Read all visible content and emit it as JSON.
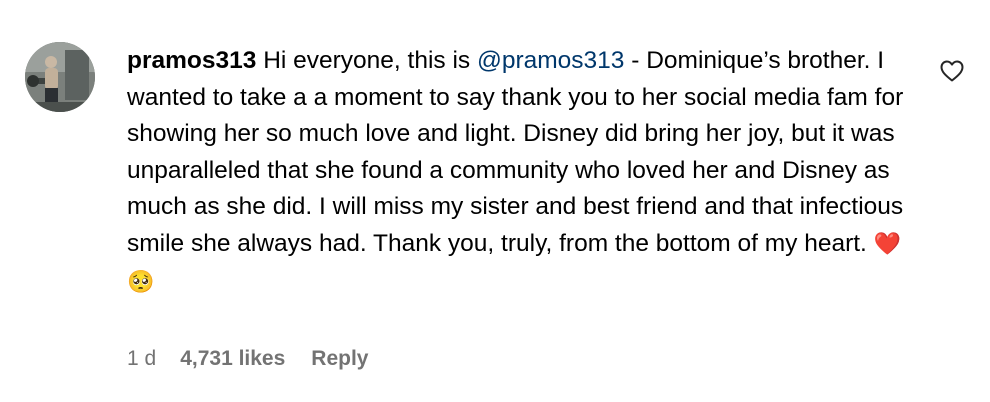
{
  "comment": {
    "username": "pramos313",
    "text_before_mention": "Hi everyone, this is ",
    "mention": "@pramos313",
    "text_after_mention": " - Dominique’s brother. I wanted to take a a moment to say thank you to her social media fam for showing her so much love and light. Disney did bring her joy, but it was unparalleled that she found a community who loved her and Disney as much as she did. I will miss my sister and best friend and that infectious smile she always had. Thank you, truly, from the bottom of my heart. ",
    "emojis": "❤️🥺"
  },
  "meta": {
    "time": "1 d",
    "likes": "4,731 likes",
    "reply": "Reply"
  },
  "icons": {
    "avatar": "profile-photo",
    "like": "heart-outline-icon"
  },
  "colors": {
    "mention": "#00376b",
    "meta": "#737373"
  }
}
